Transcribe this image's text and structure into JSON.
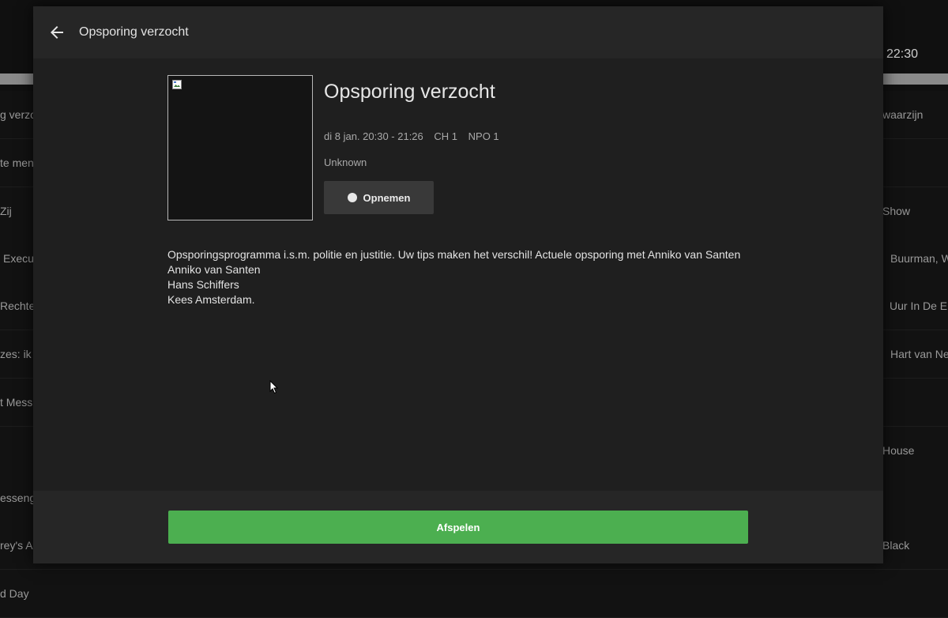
{
  "background": {
    "time": "22:30",
    "rows": [
      {
        "left": "g verzo",
        "right": "waarzijn"
      },
      {
        "left": "te mens",
        "right": ""
      },
      {
        "left": "Zij",
        "right": "Show"
      },
      {
        "left": "Execu",
        "right": "Buurman, W"
      },
      {
        "left": "Rechte",
        "right": "Uur In De E"
      },
      {
        "left": "zes: ik",
        "right": "Hart van Ne"
      },
      {
        "left": "t Mess",
        "right": ""
      },
      {
        "left": "",
        "right": "House"
      },
      {
        "left": "esseng",
        "right": ""
      },
      {
        "left": "rey's A",
        "right": "Black"
      },
      {
        "left": "d Day",
        "right": ""
      }
    ]
  },
  "dialog": {
    "header_title": "Opsporing verzocht",
    "program": {
      "title": "Opsporing verzocht",
      "datetime": "di 8 jan. 20:30 - 21:26",
      "channel_number": "CH 1",
      "channel_name": "NPO 1",
      "status": "Unknown"
    },
    "record_label": "Opnemen",
    "description": [
      "Opsporingsprogramma i.s.m. politie en justitie. Uw tips maken het verschil! Actuele opsporing met Anniko van Santen",
      "Anniko van Santen",
      "Hans Schiffers",
      "Kees Amsterdam."
    ],
    "play_label": "Afspelen"
  },
  "colors": {
    "accent_green": "#4caf50",
    "dialog_bg": "#1f1f1f",
    "header_bg": "#262626"
  }
}
